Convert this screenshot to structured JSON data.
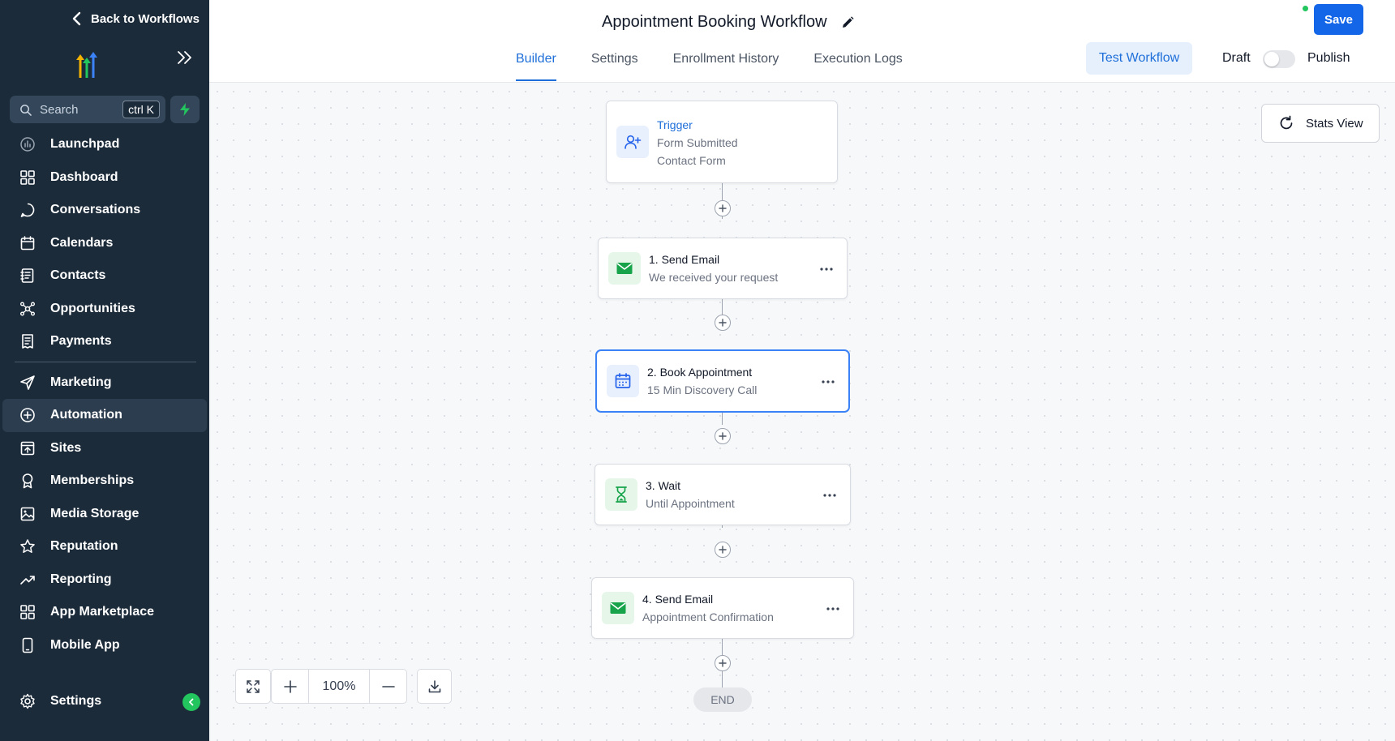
{
  "sidebar": {
    "back_label": "Back to Workflows",
    "search": {
      "placeholder": "Search",
      "shortcut": "ctrl K"
    },
    "items": [
      {
        "label": "Launchpad",
        "icon": "launchpad-icon"
      },
      {
        "label": "Dashboard",
        "icon": "dashboard-icon"
      },
      {
        "label": "Conversations",
        "icon": "chat-icon"
      },
      {
        "label": "Calendars",
        "icon": "calendar-icon"
      },
      {
        "label": "Contacts",
        "icon": "contacts-icon"
      },
      {
        "label": "Opportunities",
        "icon": "opportunities-icon"
      },
      {
        "label": "Payments",
        "icon": "payments-icon"
      },
      {
        "label": "Marketing",
        "icon": "send-icon"
      },
      {
        "label": "Automation",
        "icon": "automation-icon",
        "active": true
      },
      {
        "label": "Sites",
        "icon": "sites-icon"
      },
      {
        "label": "Memberships",
        "icon": "award-icon"
      },
      {
        "label": "Media Storage",
        "icon": "image-icon"
      },
      {
        "label": "Reputation",
        "icon": "star-icon"
      },
      {
        "label": "Reporting",
        "icon": "trend-icon"
      },
      {
        "label": "App Marketplace",
        "icon": "grid-icon"
      },
      {
        "label": "Mobile App",
        "icon": "phone-icon"
      }
    ],
    "settings_label": "Settings"
  },
  "header": {
    "title": "Appointment Booking Workflow",
    "tabs": [
      "Builder",
      "Settings",
      "Enrollment History",
      "Execution Logs"
    ],
    "active_tab": "Builder",
    "test_label": "Test Workflow",
    "draft_label": "Draft",
    "publish_label": "Publish",
    "save_label": "Save"
  },
  "canvas": {
    "stats_label": "Stats View",
    "trigger": {
      "label": "Trigger",
      "line1": "Form Submitted",
      "line2": "Contact Form"
    },
    "steps": [
      {
        "title": "1. Send Email",
        "subtitle": "We received your request",
        "icon": "mail-icon"
      },
      {
        "title": "2. Book Appointment",
        "subtitle": "15 Min Discovery Call",
        "icon": "calendar-icon"
      },
      {
        "title": "3. Wait",
        "subtitle": "Until Appointment",
        "icon": "hourglass-icon"
      },
      {
        "title": "4. Send Email",
        "subtitle": "Appointment Confirmation",
        "icon": "mail-icon"
      }
    ],
    "end_label": "END",
    "zoom": "100%"
  },
  "colors": {
    "sidebar_bg": "#1c2b3a",
    "accent": "#1366e8",
    "success": "#16a34a"
  }
}
